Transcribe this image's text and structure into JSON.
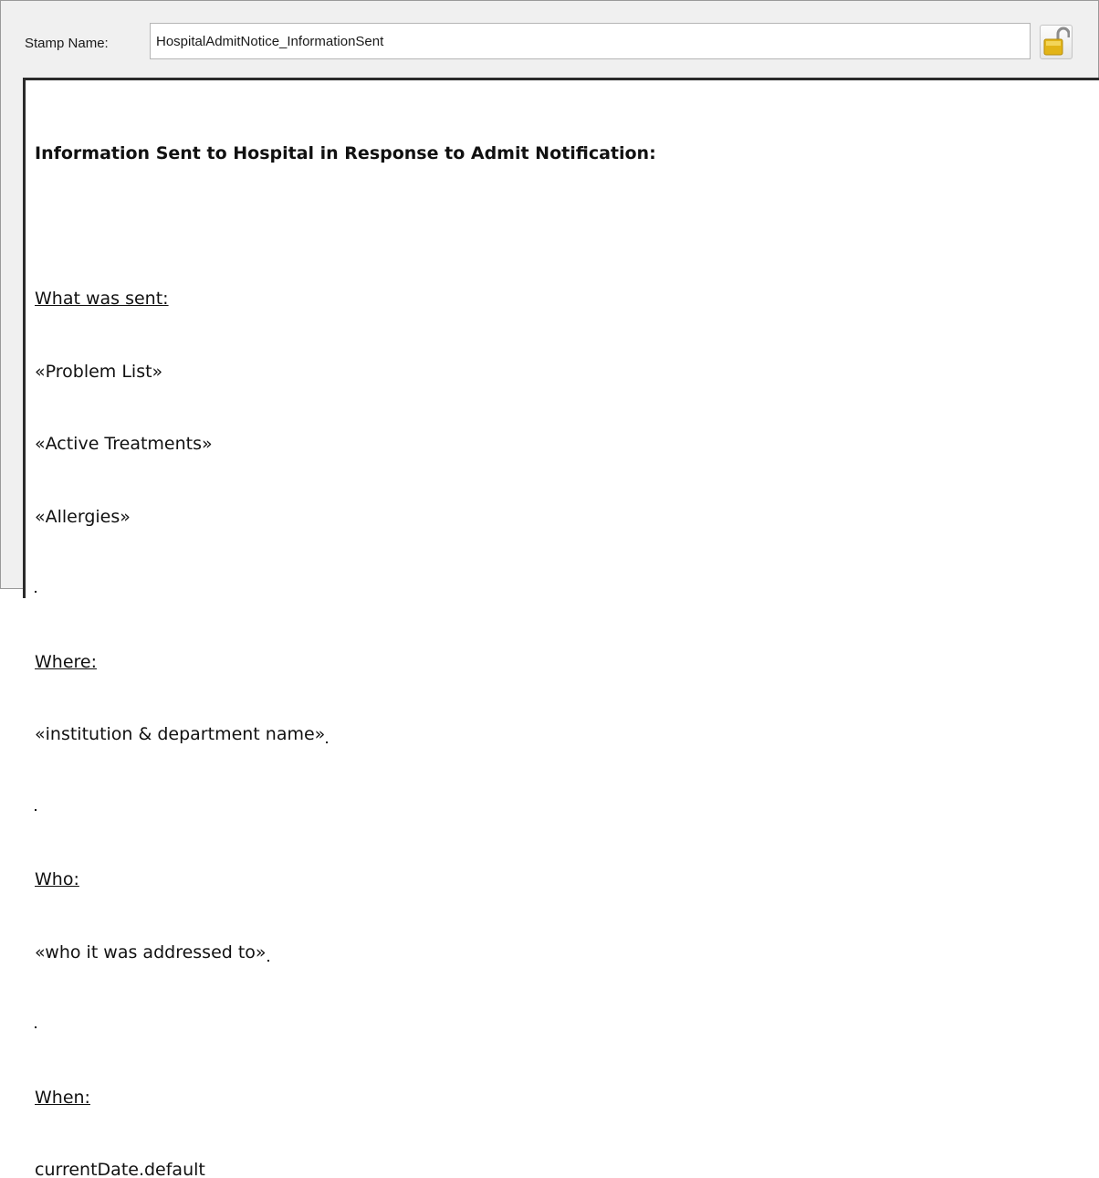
{
  "stamp": {
    "label": "Stamp Name:",
    "name_value": "HospitalAdmitNotice_InformationSent",
    "lock_icon": "unlocked-padlock"
  },
  "editor": {
    "heading": "Information Sent to Hospital in Response to Admit Notification:",
    "what_label": "What was sent:",
    "items": [
      "«Problem List»",
      "«Active Treatments»",
      "«Allergies»"
    ],
    "where_label": "Where:",
    "where_value": "«institution & department name»",
    "who_label": "Who:",
    "who_value": "«who it was addressed to»",
    "when_label": "When:",
    "when_value": "currentDate.default"
  },
  "colors": {
    "lock_gold": "#e2b417",
    "editor_border": "#2b2b2b"
  }
}
